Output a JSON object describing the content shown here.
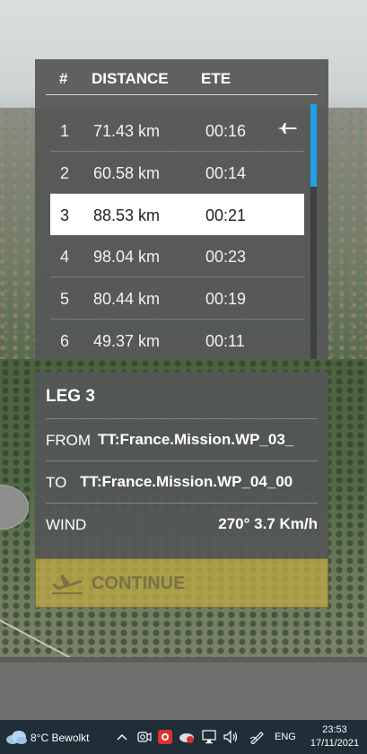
{
  "table": {
    "headers": {
      "num": "#",
      "distance": "DISTANCE",
      "ete": "ETE"
    },
    "rows": [
      {
        "num": "1",
        "distance": "71.43 km",
        "ete": "00:16"
      },
      {
        "num": "2",
        "distance": "60.58 km",
        "ete": "00:14"
      },
      {
        "num": "3",
        "distance": "88.53 km",
        "ete": "00:21"
      },
      {
        "num": "4",
        "distance": "98.04 km",
        "ete": "00:23"
      },
      {
        "num": "5",
        "distance": "80.44 km",
        "ete": "00:19"
      },
      {
        "num": "6",
        "distance": "49.37 km",
        "ete": "00:11"
      }
    ],
    "current_leg_icon": "airplane-icon",
    "selected_row": "3"
  },
  "detail": {
    "title": "LEG 3",
    "from_label": "FROM",
    "from_value": "TT:France.Mission.WP_03_",
    "to_label": "TO",
    "to_value": "TT:France.Mission.WP_04_00",
    "wind_label": "WIND",
    "wind_value": "270° 3.7 Km/h"
  },
  "continue": {
    "label": "CONTINUE",
    "icon": "airplane-takeoff-icon"
  },
  "taskbar": {
    "weather": "8°C  Bewolkt",
    "weather_icon": "cloud-icon",
    "language": "ENG",
    "time": "23:53",
    "date": "17/11/2021"
  },
  "colors": {
    "panel": "#555756",
    "accent_scroll": "#1ea0e6",
    "continue_bg": "#beaa46",
    "taskbar": "#1f2e37"
  }
}
